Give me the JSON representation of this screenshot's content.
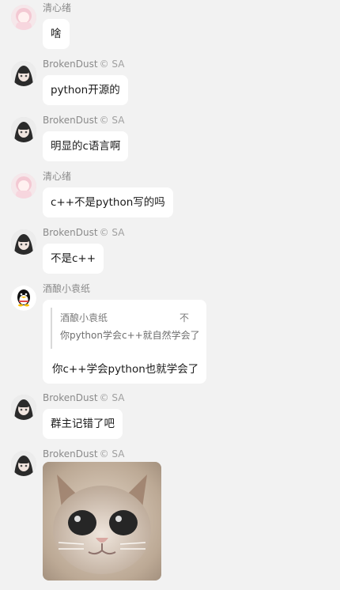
{
  "messages": [
    {
      "sender": "清心绪",
      "badge": "",
      "text": "啥"
    },
    {
      "sender": "BrokenDust",
      "badge": "© SA",
      "text": "python开源的"
    },
    {
      "sender": "BrokenDust",
      "badge": "© SA",
      "text": "明显的c语言啊"
    },
    {
      "sender": "清心绪",
      "badge": "",
      "text": "c++不是python写的吗"
    },
    {
      "sender": "BrokenDust",
      "badge": "© SA",
      "text": "不是c++"
    },
    {
      "sender": "酒酿小袁纸",
      "badge": "",
      "quote": {
        "name": "酒酿小袁纸",
        "time": "不",
        "text": "你python学会c++就自然学会了"
      },
      "text": "你c++学会python也就学会了"
    },
    {
      "sender": "BrokenDust",
      "badge": "© SA",
      "text": "群主记错了吧"
    },
    {
      "sender": "BrokenDust",
      "badge": "© SA",
      "image": "kitten-photo"
    }
  ]
}
